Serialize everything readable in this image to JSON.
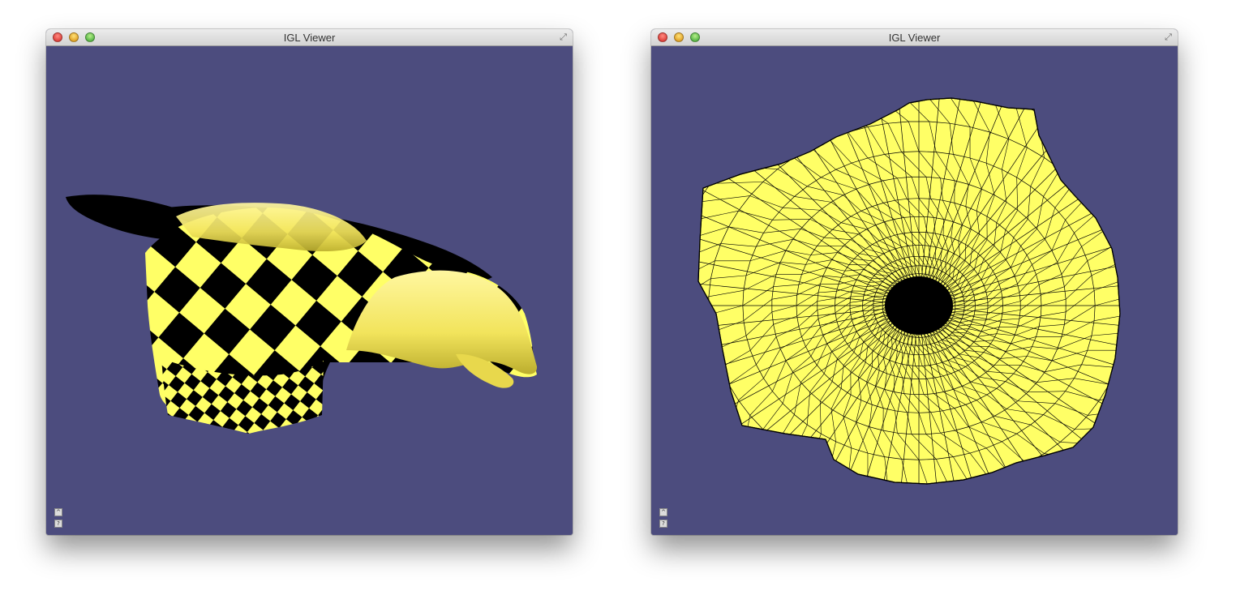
{
  "colors": {
    "background": "#4c4c7e",
    "mesh_fill": "#ffff66",
    "wire": "#000000"
  },
  "windows": [
    {
      "title": "IGL Viewer",
      "content": "checkerboard-textured 3D mesh",
      "icons": [
        "close-button",
        "minimize-button",
        "zoom-button",
        "fullscreen-icon",
        "viewer-menu-icon",
        "viewer-help-icon"
      ]
    },
    {
      "title": "IGL Viewer",
      "content": "flattened 2D triangle mesh parameterization",
      "icons": [
        "close-button",
        "minimize-button",
        "zoom-button",
        "fullscreen-icon",
        "viewer-menu-icon",
        "viewer-help-icon"
      ]
    }
  ]
}
